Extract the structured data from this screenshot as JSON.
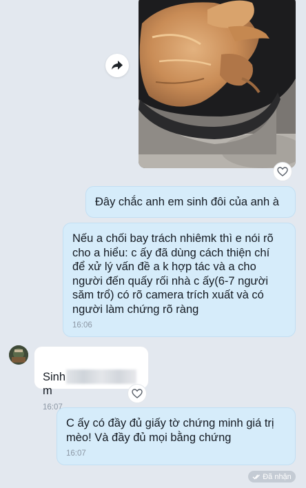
{
  "messages": {
    "sent_1": {
      "text": "Đây chắc anh em sinh đôi của anh à"
    },
    "sent_2": {
      "text": "Nếu a chối bay trách nhiêmk thì e nói rõ\ncho a hiểu: c ấy đã dùng cách thiện chí\nđể xử lý vấn đề a k hợp tác và a cho\nngười đến quấy rối nhà c ấy(6-7 người\nsăm trổ) có rõ camera trích xuất và có\nngười làm chứng rõ ràng",
      "time": "16:06"
    },
    "received_1": {
      "text_start": "Sinh",
      "text_end": "m",
      "time": "16:07"
    },
    "sent_3": {
      "text": "C ấy có đầy đủ giấy tờ chứng minh giá trị\nmèo! Và đầy đủ mọi bằng chứng",
      "time": "16:07"
    }
  },
  "status": {
    "label": "Đã nhận"
  },
  "icons": {
    "forward": "forward-arrow-icon",
    "reaction": "heart-outline-icon",
    "status": "double-check-icon"
  },
  "colors": {
    "background": "#e3e8ef",
    "sent_bubble": "#d6ecfa",
    "received_bubble": "#ffffff",
    "timestamp": "#8b96a3"
  }
}
